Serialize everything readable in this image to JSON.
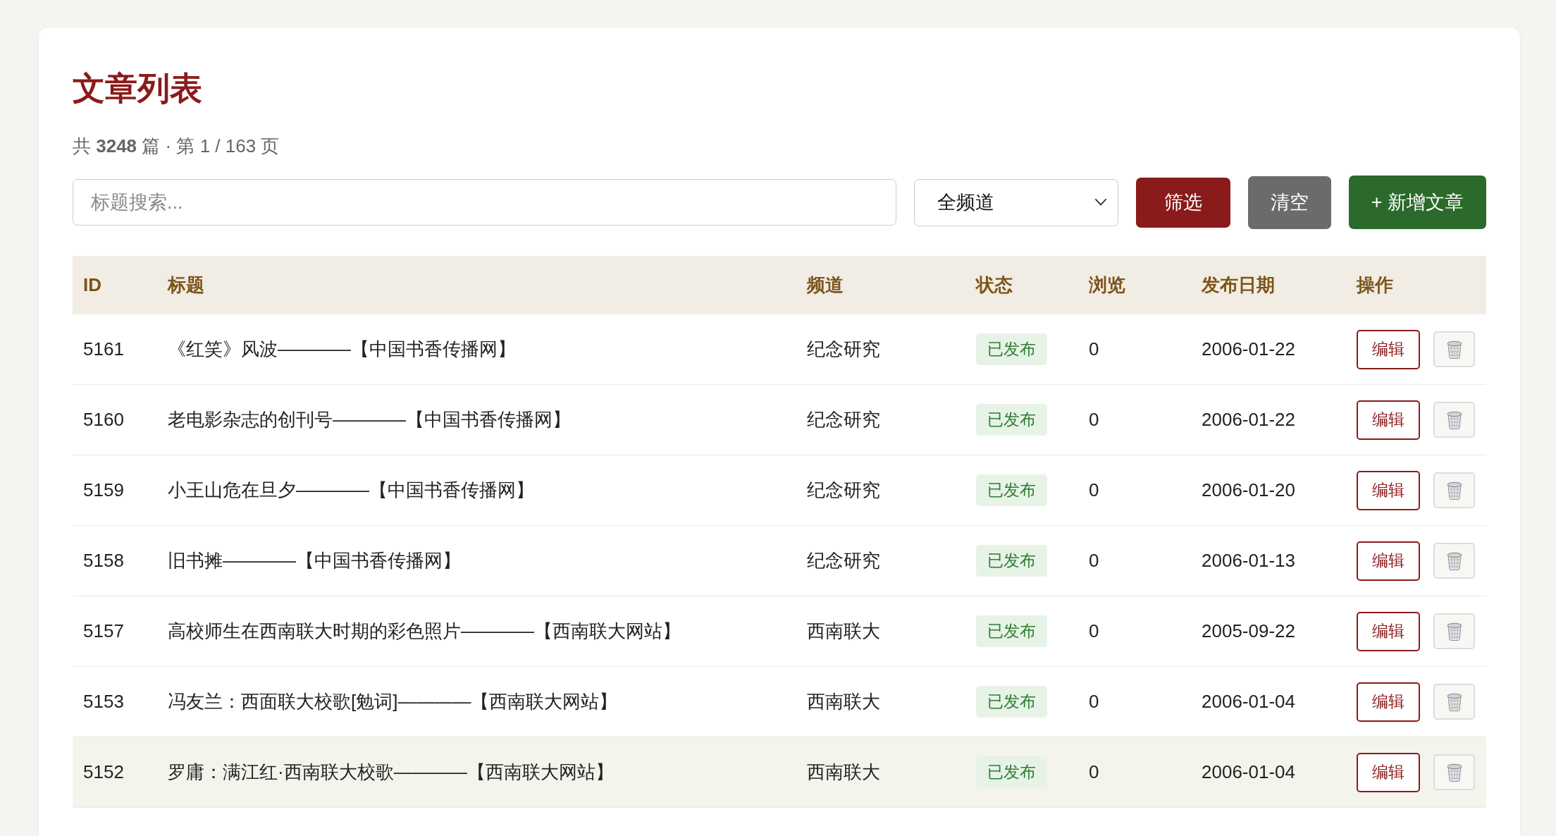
{
  "page": {
    "title": "文章列表",
    "summary": "共 **3248** 篇 · 第 1 / 163 页"
  },
  "toolbar": {
    "search": {
      "placeholder": "标题搜索..."
    },
    "channel_select": {
      "value": "全频道"
    },
    "buttons": [
      {
        "label": "筛选",
        "kind": "filter"
      },
      {
        "label": "清空",
        "kind": "clear"
      },
      {
        "label": "+ 新增文章",
        "kind": "create"
      }
    ]
  },
  "table": {
    "columns": [
      "ID",
      "标题",
      "频道",
      "状态",
      "浏览",
      "发布日期",
      "操作"
    ],
    "rows": [
      {
        "id": "5161",
        "title": "《红笑》风波————【中国书香传播网】",
        "channel": "纪念研究",
        "status": "已发布",
        "views": "0",
        "date": "2006-01-22",
        "hovered": false,
        "actions": [
          {
            "kind": "edit",
            "label": "编辑"
          },
          {
            "kind": "delete"
          }
        ]
      },
      {
        "id": "5160",
        "title": "老电影杂志的创刊号————【中国书香传播网】",
        "channel": "纪念研究",
        "status": "已发布",
        "views": "0",
        "date": "2006-01-22",
        "hovered": false,
        "actions": [
          {
            "kind": "edit",
            "label": "编辑"
          },
          {
            "kind": "delete"
          }
        ]
      },
      {
        "id": "5159",
        "title": "小王山危在旦夕————【中国书香传播网】",
        "channel": "纪念研究",
        "status": "已发布",
        "views": "0",
        "date": "2006-01-20",
        "hovered": false,
        "actions": [
          {
            "kind": "edit",
            "label": "编辑"
          },
          {
            "kind": "delete"
          }
        ]
      },
      {
        "id": "5158",
        "title": "旧书摊————【中国书香传播网】",
        "channel": "纪念研究",
        "status": "已发布",
        "views": "0",
        "date": "2006-01-13",
        "hovered": false,
        "actions": [
          {
            "kind": "edit",
            "label": "编辑"
          },
          {
            "kind": "delete"
          }
        ]
      },
      {
        "id": "5157",
        "title": "高校师生在西南联大时期的彩色照片————【西南联大网站】",
        "channel": "西南联大",
        "status": "已发布",
        "views": "0",
        "date": "2005-09-22",
        "hovered": false,
        "actions": [
          {
            "kind": "edit",
            "label": "编辑"
          },
          {
            "kind": "delete"
          }
        ]
      },
      {
        "id": "5153",
        "title": "冯友兰：西面联大校歌[勉词]————【西南联大网站】",
        "channel": "西南联大",
        "status": "已发布",
        "views": "0",
        "date": "2006-01-04",
        "hovered": false,
        "actions": [
          {
            "kind": "edit",
            "label": "编辑"
          },
          {
            "kind": "delete"
          }
        ]
      },
      {
        "id": "5152",
        "title": "罗庸：满江红·西南联大校歌————【西南联大网站】",
        "channel": "西南联大",
        "status": "已发布",
        "views": "0",
        "date": "2006-01-04",
        "hovered": true,
        "actions": [
          {
            "kind": "edit",
            "label": "编辑"
          },
          {
            "kind": "delete"
          }
        ]
      }
    ]
  }
}
